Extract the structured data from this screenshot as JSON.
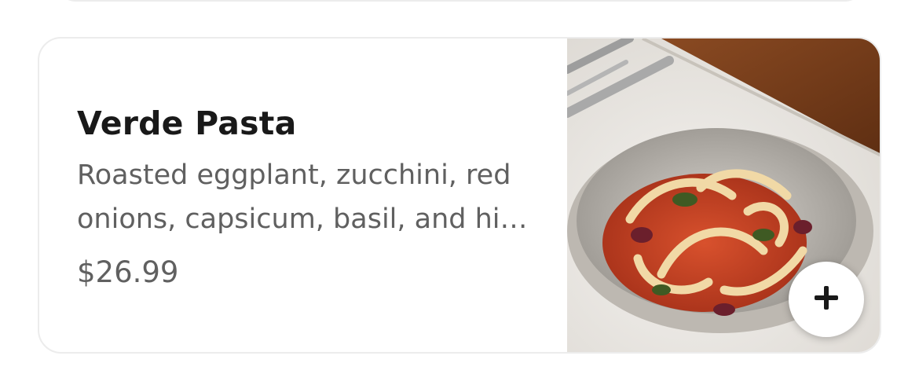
{
  "item": {
    "name": "Verde Pasta",
    "description": "Roasted eggplant, zucchini, red onions, capsicum, basil, and hi…",
    "price": "$26.99"
  },
  "actions": {
    "add_icon": "plus-icon"
  },
  "colors": {
    "title": "#191919",
    "secondary_text": "#606060",
    "card_border": "#ececec"
  }
}
